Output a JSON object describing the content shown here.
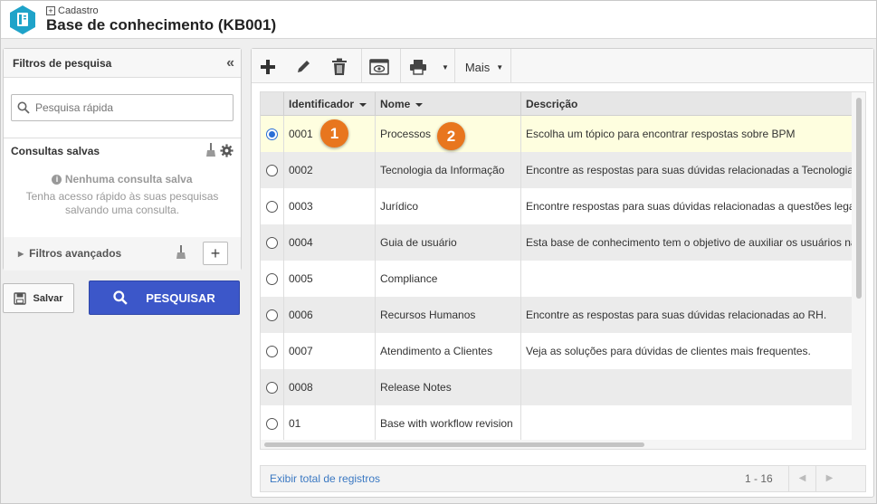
{
  "header": {
    "breadcrumb": "Cadastro",
    "title": "Base de conhecimento (KB001)"
  },
  "sidebar": {
    "title": "Filtros de pesquisa",
    "search_placeholder": "Pesquisa rápida",
    "saved_title": "Consultas salvas",
    "empty_title": "Nenhuma consulta salva",
    "empty_desc": "Tenha acesso rápido às suas pesquisas salvando uma consulta.",
    "advanced": "Filtros avançados",
    "save_label": "Salvar",
    "search_label": "PESQUISAR"
  },
  "toolbar": {
    "more_label": "Mais"
  },
  "table": {
    "columns": [
      "Identificador",
      "Nome",
      "Descrição"
    ],
    "rows": [
      {
        "id": "0001",
        "name": "Processos",
        "desc": "Escolha um tópico para encontrar respostas sobre BPM",
        "selected": true
      },
      {
        "id": "0002",
        "name": "Tecnologia da Informação",
        "desc": "Encontre as respostas para suas dúvidas relacionadas a Tecnologia da Informação"
      },
      {
        "id": "0003",
        "name": "Jurídico",
        "desc": "Encontre respostas para suas dúvidas relacionadas a questões legais"
      },
      {
        "id": "0004",
        "name": "Guia de usuário",
        "desc": "Esta base de conhecimento tem o objetivo de auxiliar os usuários na utilização"
      },
      {
        "id": "0005",
        "name": "Compliance",
        "desc": ""
      },
      {
        "id": "0006",
        "name": "Recursos Humanos",
        "desc": "Encontre as respostas para suas dúvidas relacionadas ao RH."
      },
      {
        "id": "0007",
        "name": "Atendimento a Clientes",
        "desc": "Veja as soluções para dúvidas de clientes mais frequentes."
      },
      {
        "id": "0008",
        "name": "Release Notes",
        "desc": ""
      },
      {
        "id": "01",
        "name": "Base with workflow revision",
        "desc": ""
      }
    ]
  },
  "badges": [
    "1",
    "2"
  ],
  "footer": {
    "show_total": "Exibir total de registros",
    "range": "1 - 16"
  },
  "colors": {
    "accent": "#3c57c9",
    "badge": "#e8761e",
    "selected_row": "#fefedf"
  }
}
